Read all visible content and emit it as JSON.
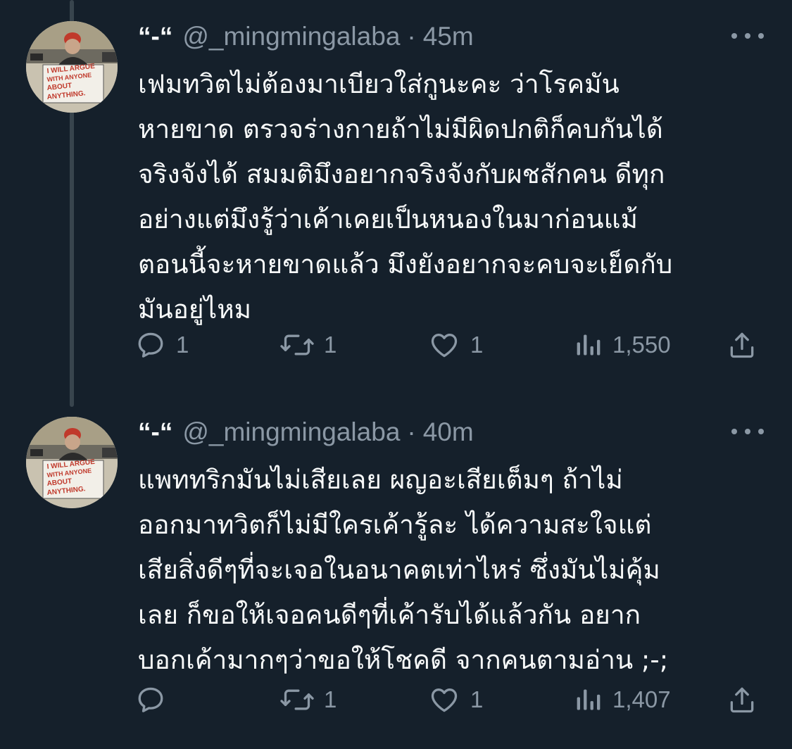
{
  "tweets": [
    {
      "display_name": "“-“",
      "handle": "@_mingmingalaba",
      "separator": "·",
      "time": "45m",
      "text": "เฟมทวิตไม่ต้องมาเบียวใส่กูนะคะ ว่าโรคมัน\nหายขาด ตรวจร่างกายถ้าไม่มีผิดปกติก็คบกันได้\nจริงจังได้ สมมติมึงอยากจริงจังกับผชสักคน ดีทุก\nอย่างแต่มึงรู้ว่าเค้าเคยเป็นหนองในมาก่อนแม้\nตอนนี้จะหายขาดแล้ว มึงยังอยากจะคบจะเย็ดกับ\nมันอยู่ไหม",
      "replies": "1",
      "retweets": "1",
      "likes": "1",
      "views": "1,550"
    },
    {
      "display_name": "“-“",
      "handle": "@_mingmingalaba",
      "separator": "·",
      "time": "40m",
      "text": "แพททริกมันไม่เสียเลย ผญอะเสียเต็มๆ ถ้าไม่\nออกมาทวิตก็ไม่มีใครเค้ารู้ละ ได้ความสะใจแต่\nเสียสิ่งดีๆที่จะเจอในอนาคตเท่าไหร่ ซึ่งมันไม่คุ้ม\nเลย ก็ขอให้เจอคนดีๆที่เค้ารับได้แล้วกัน อยาก\nบอกเค้ามากๆว่าขอให้โชคดี จากคนตามอ่าน ;-;",
      "replies": "",
      "retweets": "1",
      "likes": "1",
      "views": "1,407"
    }
  ],
  "avatar": {
    "sign_text": "I WILL ARGUE WITH ANYONE ABOUT ANYTHING."
  },
  "colors": {
    "background": "#15202b",
    "primary_text": "#f7f9f9",
    "secondary_text": "#8b98a5",
    "thread_line": "#38444d"
  },
  "icons": [
    "reply-icon",
    "retweet-icon",
    "like-icon",
    "views-icon",
    "share-icon",
    "more-icon"
  ]
}
